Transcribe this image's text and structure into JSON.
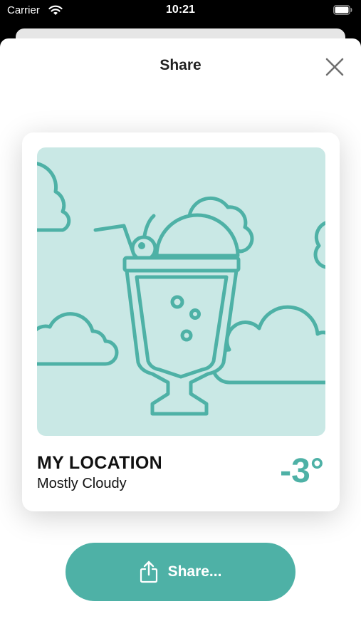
{
  "status_bar": {
    "carrier": "Carrier",
    "time": "10:21"
  },
  "sheet": {
    "title": "Share"
  },
  "card": {
    "location": "MY LOCATION",
    "condition": "Mostly Cloudy",
    "temperature": "-3°"
  },
  "share_button": {
    "label": "Share..."
  },
  "colors": {
    "accent": "#4eb1a6",
    "illustration_bg": "#c9e8e5"
  },
  "icons": {
    "close": "close-icon",
    "share": "share-icon",
    "illustration": "milkshake-illustration"
  }
}
